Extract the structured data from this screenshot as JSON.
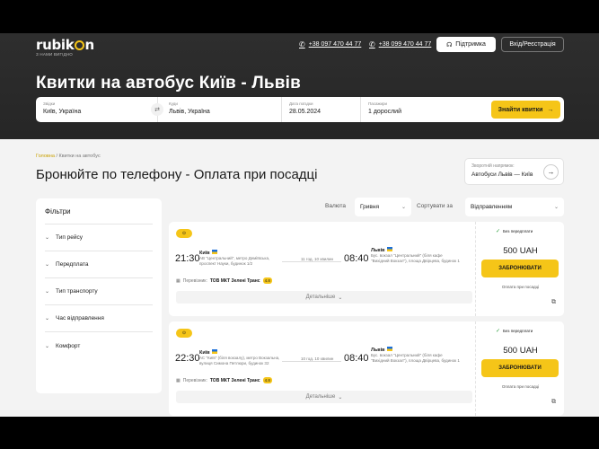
{
  "header": {
    "logo": "rubikon",
    "logo_tagline": "З НАМИ ВИГІДНО",
    "phones": [
      "+38 097 470 44 77",
      "+38 099 470 44 77"
    ],
    "support_label": "Підтримка",
    "login_label": "Вхід/Реєстрація",
    "title": "Квитки на автобус Київ - Львів"
  },
  "search": {
    "from_label": "Звідки",
    "from_value": "Київ, Україна",
    "to_label": "Куди",
    "to_value": "Львів, Україна",
    "date_label": "Дата поїздки",
    "date_value": "28.05.2024",
    "passengers_label": "Пасажири",
    "passengers_value": "1 дорослий",
    "find_label": "Знайти квитки"
  },
  "breadcrumb": {
    "home": "Головна",
    "separator": "/",
    "current": "Квитки на автобус"
  },
  "page": {
    "heading": "Бронюйте по телефону - Оплата при посадці",
    "reverse_label": "Зворотній напрямок:",
    "reverse_value": "Автобуси Львів — Київ"
  },
  "filters": {
    "title": "Фільтри",
    "items": [
      "Тип рейсу",
      "Передплата",
      "Тип транспорту",
      "Час відправлення",
      "Комфорт"
    ]
  },
  "sort": {
    "currency_label": "Валюта",
    "currency_value": "Гривня",
    "sort_label": "Сортувати за",
    "sort_value": "Відправленням"
  },
  "trips": [
    {
      "dep_time": "21:30",
      "dep_city": "Київ",
      "dep_addr": "АВ \"Центральний\", метро Деміївська, проспект Науки, будинок 1/2",
      "duration": "11 год. 10 хвилин",
      "arr_time": "08:40",
      "arr_city": "Львів",
      "arr_addr": "Бус. вокзал \"Центральний\" (біля кафе \"Вихідний Вокзал\"), площа Двірцева, будинок 1",
      "carrier_label": "Перевізник:",
      "carrier": "ТОВ МКТ Зеленi Транс",
      "rating": "4.8",
      "details": "Детальніше",
      "no_prepay": "Без передплати",
      "price": "500 UAH",
      "book": "ЗАБРОНЮВАТИ",
      "pay_note": "Оплата при посадці"
    },
    {
      "dep_time": "22:30",
      "dep_city": "Київ",
      "dep_addr": "АС \"Київ\" (біля вокзалу), метро Вокзальна, вулиця Симона Петлюри, будинок 32",
      "duration": "10 год. 10 хвилин",
      "arr_time": "08:40",
      "arr_city": "Львів",
      "arr_addr": "Бус. вокзал \"Центральний\" (біля кафе \"Вихідний Вокзал\"), площа Двірцева, будинок 1",
      "carrier_label": "Перевізник:",
      "carrier": "ТОВ МКТ Зеленi Транс",
      "rating": "4.8",
      "details": "Детальніше",
      "no_prepay": "Без передплати",
      "price": "500 UAH",
      "book": "ЗАБРОНЮВАТИ",
      "pay_note": "Оплата при посадці"
    }
  ],
  "colors": {
    "accent": "#f5c518",
    "header_bg": "#2b2b2b",
    "page_bg": "#f3f3f3"
  }
}
